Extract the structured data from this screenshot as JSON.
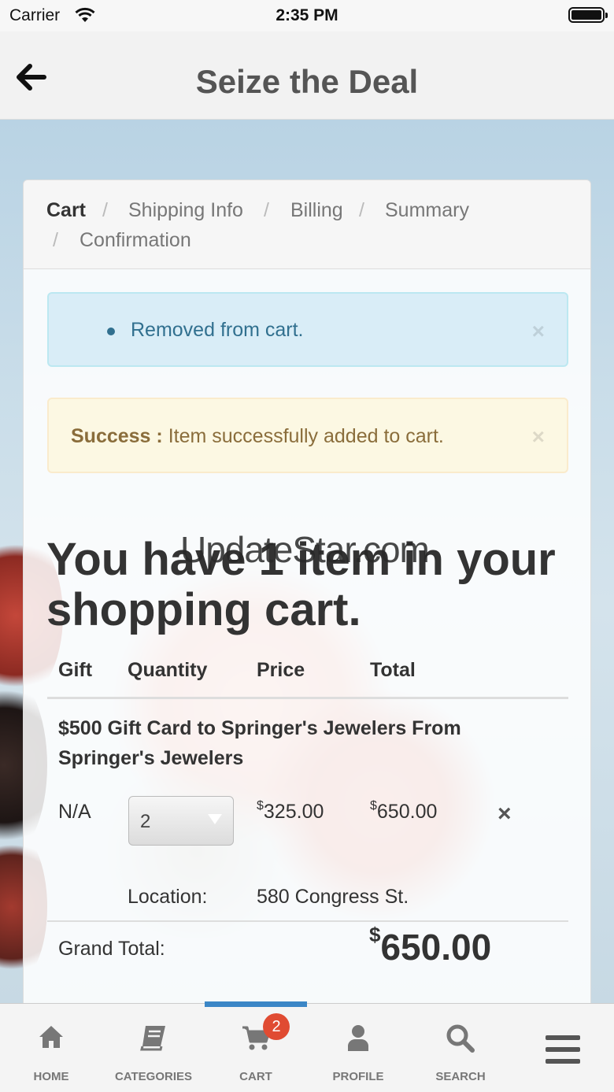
{
  "status_bar": {
    "carrier": "Carrier",
    "time": "2:35 PM"
  },
  "nav": {
    "title": "Seize the Deal"
  },
  "breadcrumb": {
    "items": [
      "Cart",
      "Shipping Info",
      "Billing",
      "Summary",
      "Confirmation"
    ],
    "separator": "/"
  },
  "alerts": {
    "info_message": "Removed from cart.",
    "success_label": "Success :",
    "success_message": "Item successfully added to cart.",
    "close_glyph": "×"
  },
  "cart": {
    "headline": "You have 1 item in your shopping cart.",
    "columns": [
      "Gift",
      "Quantity",
      "Price",
      "Total"
    ],
    "item": {
      "name": "$500 Gift Card to Springer's Jewelers From Springer's Jewelers",
      "gift": "N/A",
      "quantity": "2",
      "currency_symbol": "$",
      "price": "325.00",
      "total": "650.00",
      "location_label": "Location:",
      "location_value": "580 Congress St.",
      "remove_glyph": "×"
    },
    "grand_total_label": "Grand Total:",
    "grand_total_value": "650.00"
  },
  "watermark": "UpdateStar.com",
  "tab_bar": {
    "tabs": [
      {
        "label": "HOME",
        "icon": "home-icon"
      },
      {
        "label": "CATEGORIES",
        "icon": "book-icon"
      },
      {
        "label": "CART",
        "icon": "cart-icon"
      },
      {
        "label": "PROFILE",
        "icon": "user-icon"
      },
      {
        "label": "SEARCH",
        "icon": "search-icon"
      },
      {
        "label": "",
        "icon": "menu-icon"
      }
    ],
    "active_tab": "CART",
    "cart_badge": "2"
  },
  "colors": {
    "info_text": "#31708f",
    "success_text": "#8a6d3b",
    "active_tab_indicator": "#3b86c6",
    "badge": "#e04b32"
  }
}
